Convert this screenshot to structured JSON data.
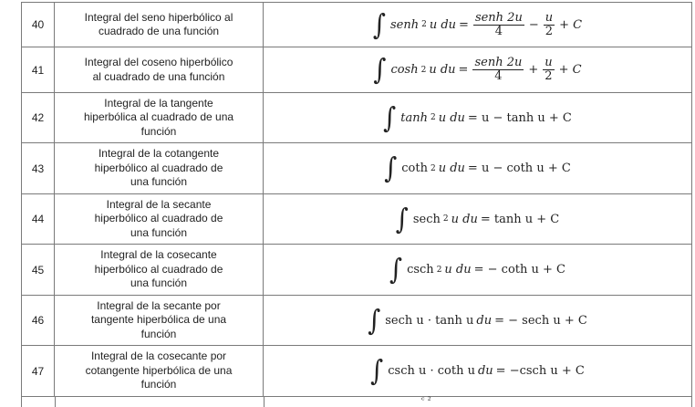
{
  "rows": [
    {
      "num": "40",
      "desc": [
        "Integral del seno hiperbólico al",
        "cuadrado de una función"
      ],
      "formula": {
        "integrand": "senh",
        "power": "2",
        "var": "u du",
        "equals": "=",
        "frac1_num": "senh 2u",
        "frac1_den": "4",
        "op": "−",
        "frac2_num": "u",
        "frac2_den": "2",
        "tail": "+ C"
      }
    },
    {
      "num": "41",
      "desc": [
        "Integral del coseno hiperbólico",
        "al cuadrado de una función"
      ],
      "formula": {
        "integrand": "cosh",
        "power": "2",
        "var": "u du",
        "equals": "=",
        "frac1_num": "senh 2u",
        "frac1_den": "4",
        "op": "+",
        "frac2_num": "u",
        "frac2_den": "2",
        "tail": "+ C"
      }
    },
    {
      "num": "42",
      "desc": [
        "Integral de la tangente",
        "hiperbólica al cuadrado de una",
        "función"
      ],
      "formula": {
        "integrand": "tanh",
        "power": "2",
        "var": "u du",
        "rhs": "= u − tanh u + C"
      }
    },
    {
      "num": "43",
      "desc": [
        "Integral de la cotangente",
        "hiperbólico al cuadrado de",
        "una función"
      ],
      "formula": {
        "integrand": "coth",
        "power": "2",
        "var": "u du",
        "rhs": "= u − coth u + C"
      }
    },
    {
      "num": "44",
      "desc": [
        "Integral de la secante",
        "hiperbólico al cuadrado de",
        "una función"
      ],
      "formula": {
        "integrand": "sech",
        "power": "2",
        "var": "u du",
        "rhs": "= tanh u + C"
      }
    },
    {
      "num": "45",
      "desc": [
        "Integral de la cosecante",
        "hiperbólico al cuadrado de",
        "una función"
      ],
      "formula": {
        "integrand": "csch",
        "power": "2",
        "var": "u du",
        "rhs": "= − coth u + C"
      }
    },
    {
      "num": "46",
      "desc": [
        "Integral de la secante por",
        "tangente hiperbólica de una",
        "función"
      ],
      "formula": {
        "integrand": "sech u · tanh u",
        "var": "du",
        "rhs": "= − sech u + C"
      }
    },
    {
      "num": "47",
      "desc": [
        "Integral de la cosecante por",
        "cotangente hiperbólica de una",
        "función"
      ],
      "formula": {
        "integrand": "csch u · coth u",
        "var": "du",
        "rhs": "= −csch u + C"
      }
    }
  ],
  "integral_sign": "∫",
  "partial_row_glyph": "ᶜ ²"
}
